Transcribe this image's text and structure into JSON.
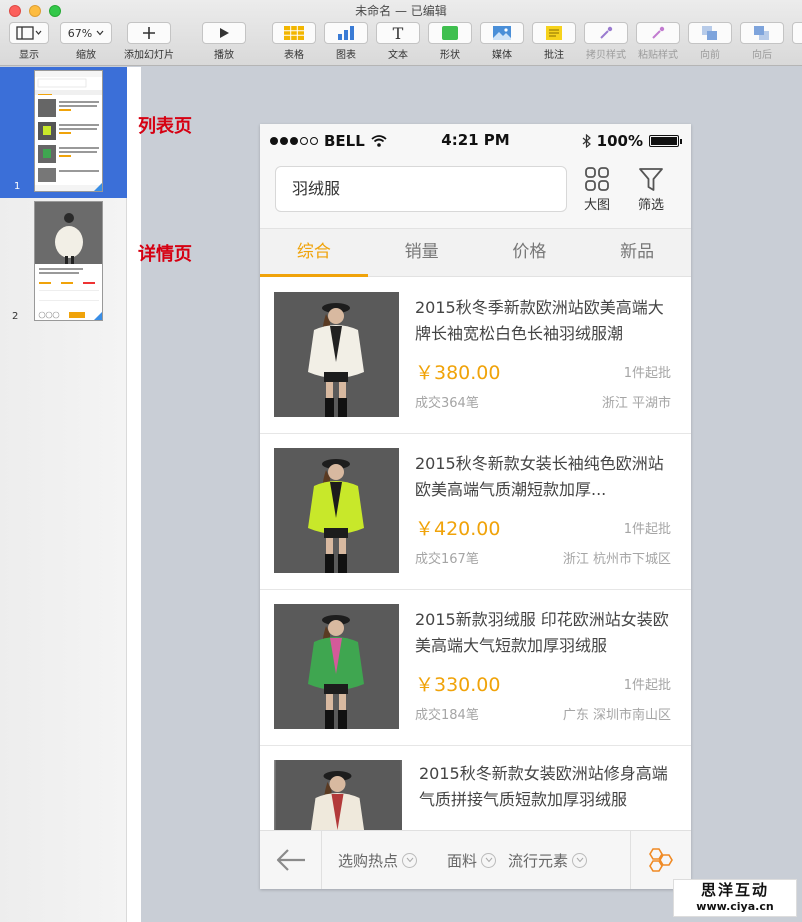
{
  "window": {
    "title": "未命名 — 已编辑"
  },
  "toolbar": {
    "view": "显示",
    "zoom_value": "67%",
    "zoom": "缩放",
    "add_slide": "添加幻灯片",
    "play": "播放",
    "table": "表格",
    "chart": "图表",
    "text": "文本",
    "shape": "形状",
    "media": "媒体",
    "comment": "批注",
    "copy_style": "拷贝样式",
    "paste_style": "粘贴样式",
    "forward": "向前",
    "backward": "向后",
    "text_glyph": "T"
  },
  "sidebar": {
    "slides": [
      {
        "number": "1"
      },
      {
        "number": "2"
      }
    ]
  },
  "canvas": {
    "label_list": "列表页",
    "label_detail": "详情页"
  },
  "phone": {
    "status": {
      "carrier": "BELL",
      "time": "4:21 PM",
      "battery": "100%"
    },
    "search": {
      "value": "羽绒服",
      "grid_label": "大图",
      "filter_label": "筛选"
    },
    "tabs": [
      "综合",
      "销量",
      "价格",
      "新品"
    ],
    "products": [
      {
        "title": "2015秋冬季新款欧洲站欧美高端大牌长袖宽松白色长袖羽绒服潮",
        "price": "￥380.00",
        "moq": "1件起批",
        "sold": "成交364笔",
        "location": "浙江 平湖市",
        "jacket_color": "#f2efe6",
        "accent_color": "#222222"
      },
      {
        "title": "2015秋冬新款女装长袖纯色欧洲站欧美高端气质潮短款加厚...",
        "price": "￥420.00",
        "moq": "1件起批",
        "sold": "成交167笔",
        "location": "浙江 杭州市下城区",
        "jacket_color": "#c8e82a",
        "accent_color": "#1c1c1c"
      },
      {
        "title": "2015新款羽绒服 印花欧洲站女装欧美高端大气短款加厚羽绒服",
        "price": "￥330.00",
        "moq": "1件起批",
        "sold": "成交184笔",
        "location": "广东 深圳市南山区",
        "jacket_color": "#3fa650",
        "accent_color": "#d45a9a"
      },
      {
        "title": "2015秋冬新款女装欧洲站修身高端气质拼接气质短款加厚羽绒服",
        "price": "",
        "moq": "",
        "sold": "",
        "location": "",
        "jacket_color": "#efe9dc",
        "accent_color": "#b23a3a"
      }
    ],
    "bottom": {
      "filter_1": "选购热点",
      "filter_2": "面料",
      "filter_3": "流行元素"
    },
    "accent": "#f0a30a"
  },
  "watermark": {
    "line1": "思洋互动",
    "line2": "www.ciya.cn"
  }
}
